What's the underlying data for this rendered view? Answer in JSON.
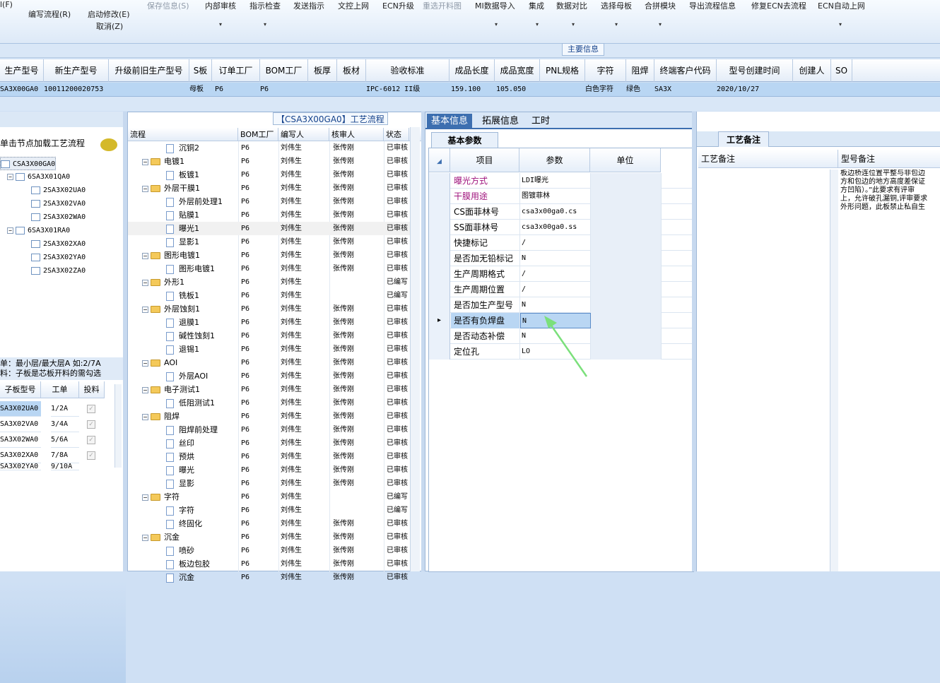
{
  "toolbar": {
    "items": [
      {
        "label": "编写流程(R)",
        "enabled": true
      },
      {
        "label": "启动修改(E)",
        "enabled": true
      },
      {
        "label": "取消(Z)",
        "enabled": true
      },
      {
        "label": "保存信息(S)",
        "enabled": false
      },
      {
        "label": "内部审核",
        "enabled": true
      },
      {
        "label": "指示检查",
        "enabled": true
      },
      {
        "label": "发送指示",
        "enabled": true
      },
      {
        "label": "文控上网",
        "enabled": true
      },
      {
        "label": "ECN升级",
        "enabled": true
      },
      {
        "label": "重选开料图",
        "enabled": false
      },
      {
        "label": "MI数据导入",
        "enabled": true
      },
      {
        "label": "集成",
        "enabled": true
      },
      {
        "label": "数据对比",
        "enabled": true
      },
      {
        "label": "选择母板",
        "enabled": true
      },
      {
        "label": "合拼模块",
        "enabled": true
      },
      {
        "label": "导出流程信息",
        "enabled": true
      },
      {
        "label": "修复ECN去流程",
        "enabled": true
      },
      {
        "label": "ECN自动上网",
        "enabled": true
      }
    ],
    "partial_left": "l(F)",
    "main_info_label": "主要信息"
  },
  "main_table": {
    "headers": [
      "生产型号",
      "新生产型号",
      "升级前旧生产型号",
      "S板",
      "订单工厂",
      "BOM工厂",
      "板厚",
      "板材",
      "验收标准",
      "成品长度",
      "成品宽度",
      "PNL规格",
      "字符",
      "阻焊",
      "终端客户代码",
      "型号创建时间",
      "创建人",
      "SO"
    ],
    "row": [
      "SA3X00GA0",
      "10011200020753",
      "",
      "母板",
      "P6",
      "P6",
      "",
      "",
      "IPC-6012 II级",
      "159.100",
      "105.050",
      "",
      "白色字符",
      "绿色",
      "SA3X",
      "2020/10/27",
      "",
      ""
    ]
  },
  "left_panel": {
    "hint": "单击节点加载工艺流程",
    "tree": [
      {
        "label": "CSA3X00GA0",
        "level": 0
      },
      {
        "label": "6SA3X01QA0",
        "level": 1
      },
      {
        "label": "2SA3X02UA0",
        "level": 2
      },
      {
        "label": "2SA3X02VA0",
        "level": 2
      },
      {
        "label": "2SA3X02WA0",
        "level": 2
      },
      {
        "label": "6SA3X01RA0",
        "level": 1
      },
      {
        "label": "2SA3X02XA0",
        "level": 2
      },
      {
        "label": "2SA3X02YA0",
        "level": 2
      },
      {
        "label": "2SA3X02ZA0",
        "level": 2
      }
    ],
    "note_line1": "单：最小层/最大层A 如:2/7A",
    "note_line2": "料：子板是芯板开料的需勾选",
    "subgrid_headers": [
      "子板型号",
      "工单",
      "投料"
    ],
    "subgrid_rows": [
      {
        "model": "SA3X02UA0",
        "order": "1/2A"
      },
      {
        "model": "SA3X02VA0",
        "order": "3/4A"
      },
      {
        "model": "SA3X02WA0",
        "order": "5/6A"
      },
      {
        "model": "SA3X02XA0",
        "order": "7/8A"
      },
      {
        "model": "SA3X02YA0",
        "order": "9/10A"
      }
    ]
  },
  "process_panel": {
    "title": "【CSA3X00GA0】工艺流程",
    "headers": [
      "流程",
      "BOM工厂",
      "编写人",
      "核审人",
      "状态"
    ],
    "rows": [
      {
        "name": "沉铜2",
        "type": "doc",
        "bom": "P6",
        "writer": "刘伟生",
        "reviewer": "张传刚",
        "status": "已审核"
      },
      {
        "name": "电镀1",
        "type": "folder",
        "bom": "P6",
        "writer": "刘伟生",
        "reviewer": "张传刚",
        "status": "已审核"
      },
      {
        "name": "板镀1",
        "type": "doc",
        "bom": "P6",
        "writer": "刘伟生",
        "reviewer": "张传刚",
        "status": "已审核"
      },
      {
        "name": "外层干膜1",
        "type": "folder",
        "bom": "P6",
        "writer": "刘伟生",
        "reviewer": "张传刚",
        "status": "已审核"
      },
      {
        "name": "外层前处理1",
        "type": "doc",
        "bom": "P6",
        "writer": "刘伟生",
        "reviewer": "张传刚",
        "status": "已审核"
      },
      {
        "name": "贴膜1",
        "type": "doc",
        "bom": "P6",
        "writer": "刘伟生",
        "reviewer": "张传刚",
        "status": "已审核"
      },
      {
        "name": "曝光1",
        "type": "doc",
        "bom": "P6",
        "writer": "刘伟生",
        "reviewer": "张传刚",
        "status": "已审核",
        "selected": true
      },
      {
        "name": "显影1",
        "type": "doc",
        "bom": "P6",
        "writer": "刘伟生",
        "reviewer": "张传刚",
        "status": "已审核"
      },
      {
        "name": "图形电镀1",
        "type": "folder",
        "bom": "P6",
        "writer": "刘伟生",
        "reviewer": "张传刚",
        "status": "已审核"
      },
      {
        "name": "图形电镀1",
        "type": "doc",
        "bom": "P6",
        "writer": "刘伟生",
        "reviewer": "张传刚",
        "status": "已审核"
      },
      {
        "name": "外形1",
        "type": "folder",
        "bom": "P6",
        "writer": "刘伟生",
        "reviewer": "",
        "status": "已编写"
      },
      {
        "name": "铣板1",
        "type": "doc",
        "bom": "P6",
        "writer": "刘伟生",
        "reviewer": "",
        "status": "已编写"
      },
      {
        "name": "外层蚀刻1",
        "type": "folder",
        "bom": "P6",
        "writer": "刘伟生",
        "reviewer": "张传刚",
        "status": "已审核"
      },
      {
        "name": "退膜1",
        "type": "doc",
        "bom": "P6",
        "writer": "刘伟生",
        "reviewer": "张传刚",
        "status": "已审核"
      },
      {
        "name": "碱性蚀刻1",
        "type": "doc",
        "bom": "P6",
        "writer": "刘伟生",
        "reviewer": "张传刚",
        "status": "已审核"
      },
      {
        "name": "退锡1",
        "type": "doc",
        "bom": "P6",
        "writer": "刘伟生",
        "reviewer": "张传刚",
        "status": "已审核"
      },
      {
        "name": "AOI",
        "type": "folder",
        "bom": "P6",
        "writer": "刘伟生",
        "reviewer": "张传刚",
        "status": "已审核"
      },
      {
        "name": "外层AOI",
        "type": "doc",
        "bom": "P6",
        "writer": "刘伟生",
        "reviewer": "张传刚",
        "status": "已审核"
      },
      {
        "name": "电子测试1",
        "type": "folder",
        "bom": "P6",
        "writer": "刘伟生",
        "reviewer": "张传刚",
        "status": "已审核"
      },
      {
        "name": "低阻测试1",
        "type": "doc",
        "bom": "P6",
        "writer": "刘伟生",
        "reviewer": "张传刚",
        "status": "已审核"
      },
      {
        "name": "阻焊",
        "type": "folder",
        "bom": "P6",
        "writer": "刘伟生",
        "reviewer": "张传刚",
        "status": "已审核"
      },
      {
        "name": "阻焊前处理",
        "type": "doc",
        "bom": "P6",
        "writer": "刘伟生",
        "reviewer": "张传刚",
        "status": "已审核"
      },
      {
        "name": "丝印",
        "type": "doc",
        "bom": "P6",
        "writer": "刘伟生",
        "reviewer": "张传刚",
        "status": "已审核"
      },
      {
        "name": "预烘",
        "type": "doc",
        "bom": "P6",
        "writer": "刘伟生",
        "reviewer": "张传刚",
        "status": "已审核"
      },
      {
        "name": "曝光",
        "type": "doc",
        "bom": "P6",
        "writer": "刘伟生",
        "reviewer": "张传刚",
        "status": "已审核"
      },
      {
        "name": "显影",
        "type": "doc",
        "bom": "P6",
        "writer": "刘伟生",
        "reviewer": "张传刚",
        "status": "已审核"
      },
      {
        "name": "字符",
        "type": "folder",
        "bom": "P6",
        "writer": "刘伟生",
        "reviewer": "",
        "status": "已编写"
      },
      {
        "name": "字符",
        "type": "doc",
        "bom": "P6",
        "writer": "刘伟生",
        "reviewer": "",
        "status": "已编写"
      },
      {
        "name": "终固化",
        "type": "doc",
        "bom": "P6",
        "writer": "刘伟生",
        "reviewer": "张传刚",
        "status": "已审核"
      },
      {
        "name": "沉金",
        "type": "folder",
        "bom": "P6",
        "writer": "刘伟生",
        "reviewer": "张传刚",
        "status": "已审核"
      },
      {
        "name": "喷砂",
        "type": "doc",
        "bom": "P6",
        "writer": "刘伟生",
        "reviewer": "张传刚",
        "status": "已审核"
      },
      {
        "name": "板边包胶",
        "type": "doc",
        "bom": "P6",
        "writer": "刘伟生",
        "reviewer": "张传刚",
        "status": "已审核"
      },
      {
        "name": "沉金",
        "type": "doc",
        "bom": "P6",
        "writer": "刘伟生",
        "reviewer": "张传刚",
        "status": "已审核"
      }
    ]
  },
  "info_panel": {
    "tabs": [
      "基本信息",
      "拓展信息",
      "工时"
    ],
    "subtab": "基本参数",
    "headers": [
      "项目",
      "参数",
      "单位"
    ],
    "rows": [
      {
        "key": "曝光方式",
        "value": "LDI曝光",
        "highlight": true
      },
      {
        "key": "干膜用途",
        "value": "图镀菲林",
        "highlight": true
      },
      {
        "key": "CS面菲林号",
        "value": "csa3x00ga0.cs"
      },
      {
        "key": "SS面菲林号",
        "value": "csa3x00ga0.ss"
      },
      {
        "key": "快捷标记",
        "value": "/"
      },
      {
        "key": "是否加无铅标记",
        "value": "N"
      },
      {
        "key": "生产周期格式",
        "value": "/"
      },
      {
        "key": "生产周期位置",
        "value": "/"
      },
      {
        "key": "是否加生产型号",
        "value": "N"
      },
      {
        "key": "是否有负焊盘",
        "value": "N",
        "selected": true
      },
      {
        "key": "是否动态补偿",
        "value": "N"
      },
      {
        "key": "定位孔",
        "value": "LO"
      }
    ]
  },
  "notes_panel": {
    "tab": "工艺备注",
    "headers": [
      "工艺备注",
      "型号备注"
    ],
    "model_note_lines": [
      "板边桥连位置平整与非包边",
      "方和包边的地方高度差保证",
      "方凹陷）。”此要求有评审",
      "上，允许破孔漏铜,评审要求",
      "外形问题，此板禁止私自生"
    ]
  },
  "colors": {
    "accent": "#3d6fb0",
    "selection": "#b9d6f3",
    "highlight_text": "#a0147d",
    "arrow": "#7be07b"
  }
}
